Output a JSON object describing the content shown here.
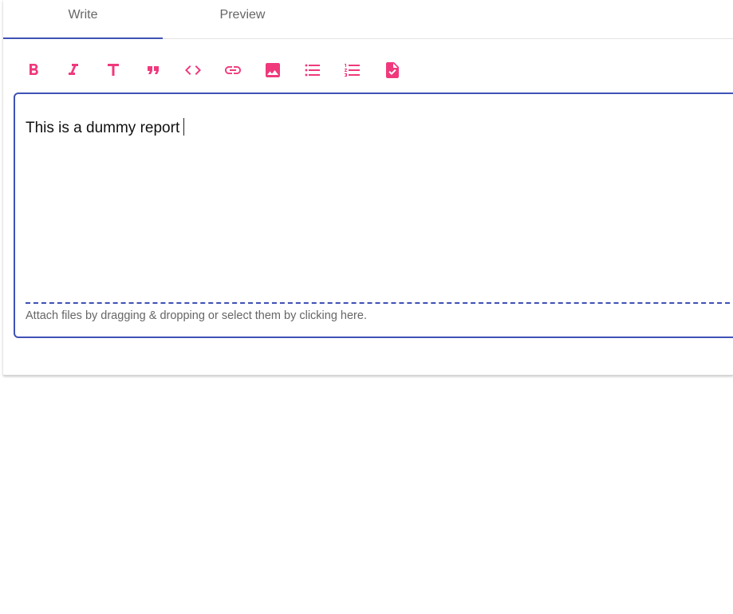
{
  "tabs": [
    {
      "label": "Write",
      "active": true
    },
    {
      "label": "Preview",
      "active": false
    }
  ],
  "toolbar": {
    "accent_color": "#f0397c",
    "buttons": [
      {
        "name": "bold",
        "icon": "bold-icon"
      },
      {
        "name": "italic",
        "icon": "italic-icon"
      },
      {
        "name": "heading",
        "icon": "heading-icon"
      },
      {
        "name": "quote",
        "icon": "quote-icon"
      },
      {
        "name": "code",
        "icon": "code-icon"
      },
      {
        "name": "link",
        "icon": "link-icon"
      },
      {
        "name": "image",
        "icon": "image-icon"
      },
      {
        "name": "bulleted-list",
        "icon": "bulleted-list-icon"
      },
      {
        "name": "numbered-list",
        "icon": "numbered-list-icon"
      },
      {
        "name": "task-list",
        "icon": "task-list-icon"
      }
    ]
  },
  "editor": {
    "value": "This is a dummy report",
    "border_color": "#3f51b5",
    "attach_hint": "Attach files by dragging & dropping or select them by clicking here."
  }
}
